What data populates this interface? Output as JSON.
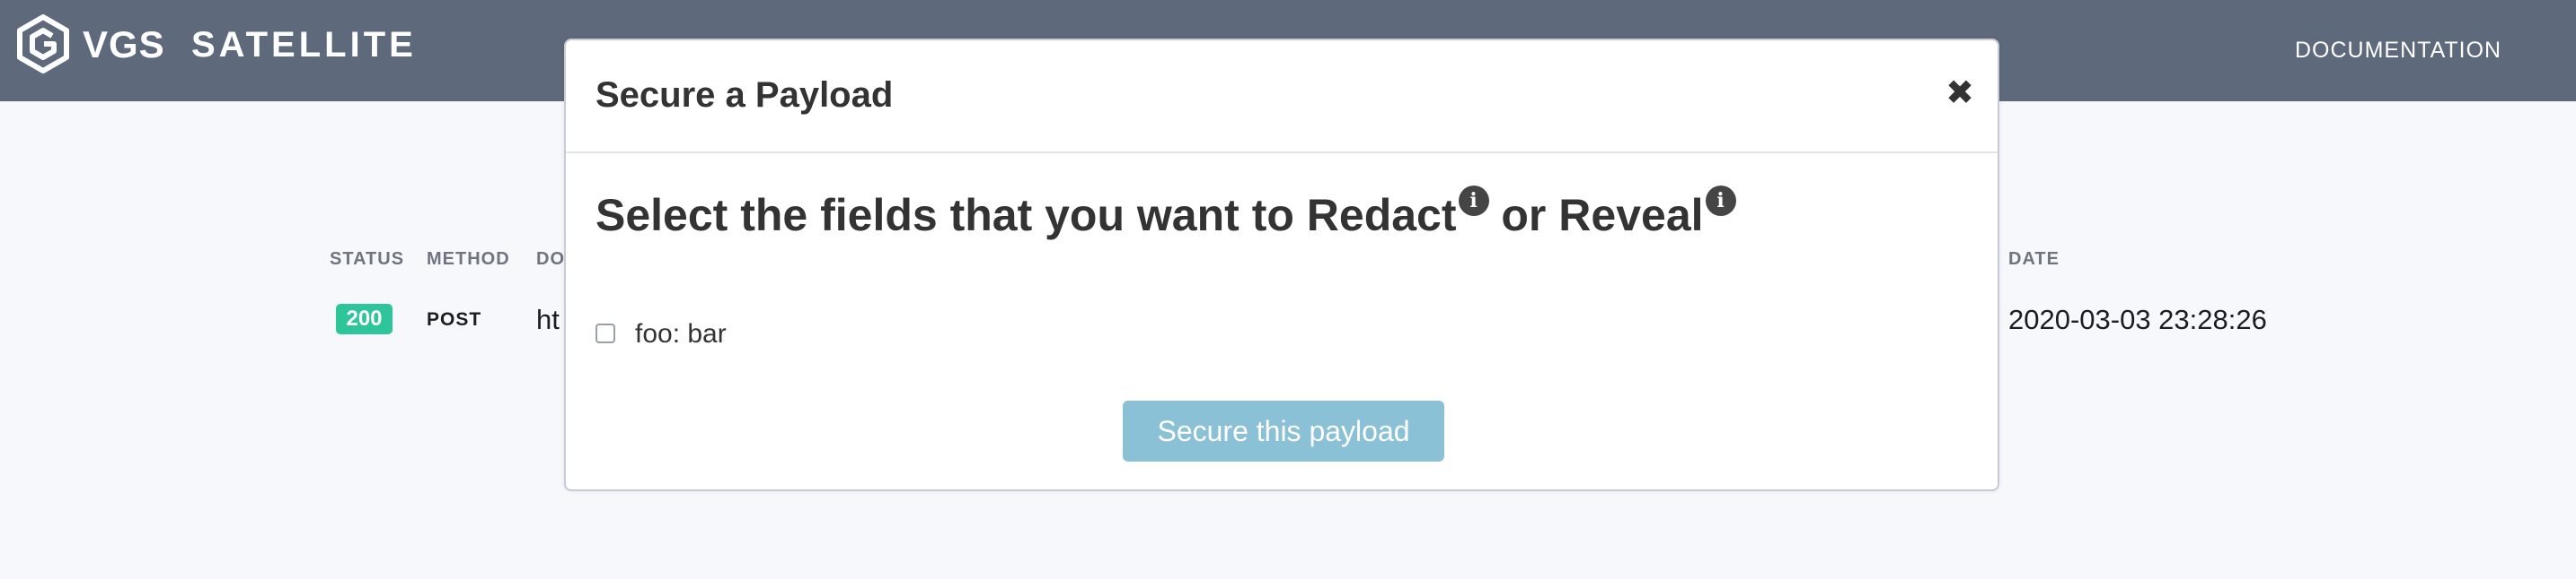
{
  "navbar": {
    "brand_short": "VGS",
    "brand_product": "SATELLITE",
    "documentation_link": "DOCUMENTATION",
    "logo_icon": "vgs-hexagon-logo-icon",
    "background_color": "#5e6a7b"
  },
  "table": {
    "headers": {
      "status": "STATUS",
      "method": "METHOD",
      "domain_partial": "DO",
      "date": "DATE"
    },
    "rows": [
      {
        "status": "200",
        "method": "POST",
        "url_partial": "ht",
        "date": "2020-03-03 23:28:26"
      }
    ],
    "status_success_color": "#2fc59a"
  },
  "modal": {
    "title": "Secure a Payload",
    "close_icon": "close-icon",
    "heading_part1": "Select the fields that you want to Redact",
    "heading_part2": " or Reveal",
    "info_glyph": "i",
    "fields": [
      {
        "label": "foo: bar",
        "checked": false
      }
    ],
    "submit_label": "Secure this payload",
    "submit_color": "#8ac1d6"
  }
}
